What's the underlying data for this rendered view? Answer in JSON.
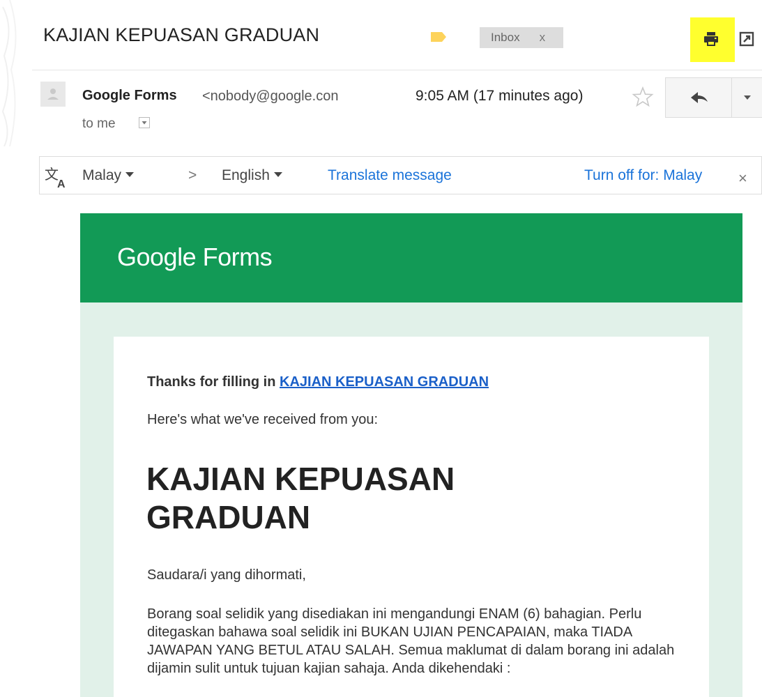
{
  "email": {
    "subject": "KAJIAN KEPUASAN GRADUAN",
    "label_chip": {
      "text": "Inbox",
      "close": "x"
    },
    "sender": {
      "name": "Google Forms",
      "email": "<nobody@google.con"
    },
    "timestamp": "9:05 AM (17 minutes ago)",
    "recipient": "to me"
  },
  "translate_bar": {
    "from_language": "Malay",
    "arrow": ">",
    "to_language": "English",
    "translate_link": "Translate message",
    "turn_off_link": "Turn off for: Malay",
    "close": "×"
  },
  "body": {
    "banner": {
      "logo_part1": "Google",
      "logo_part2": " Forms"
    },
    "thanks_prefix": "Thanks for filling in ",
    "thanks_link": "KAJIAN KEPUASAN GRADUAN",
    "received_text": "Here's what we've received from you:",
    "form_title": "KAJIAN KEPUASAN GRADUAN",
    "greeting": "Saudara/i yang dihormati,",
    "description": "Borang soal selidik yang disediakan ini mengandungi ENAM (6) bahagian. Perlu ditegaskan bahawa soal selidik ini BUKAN UJIAN PENCAPAIAN, maka TIADA JAWAPAN YANG BETUL ATAU SALAH. Semua maklumat di dalam borang ini adalah dijamin sulit untuk tujuan kajian sahaja. Anda dikehendaki :"
  },
  "colors": {
    "banner_green": "#129a56",
    "panel_mint": "#e1f1e9",
    "link_blue": "#1a5fc8",
    "highlight_yellow": "#ffff2e",
    "label_tag_yellow": "#fdd35b"
  },
  "icons": {
    "label": "label-tag-icon",
    "print": "printer-icon",
    "popout": "new-window-icon",
    "avatar": "person-icon",
    "star": "star-icon",
    "reply": "reply-arrow-icon",
    "more": "caret-down-icon",
    "translate": "translate-icon"
  }
}
